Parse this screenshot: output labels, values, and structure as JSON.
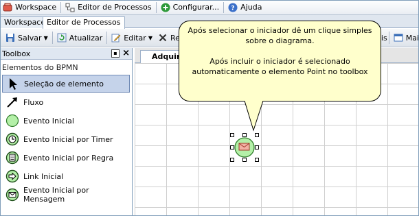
{
  "menubar": {
    "items": [
      {
        "label": "Workspace",
        "icon": "workspace-icon"
      },
      {
        "label": "Editor de Processos",
        "icon": "process-editor-icon"
      },
      {
        "label": "Configurar...",
        "icon": "add-icon"
      },
      {
        "label": "Ajuda",
        "icon": "help-icon"
      }
    ]
  },
  "tabs": [
    {
      "label": "Workspace",
      "active": false
    },
    {
      "label": "Editor de Processos",
      "active": true
    }
  ],
  "toolbar": {
    "save_label": "Salvar",
    "refresh_label": "Atualizar",
    "edit_label": "Editar",
    "remove_label": "Rem",
    "roles_label": "éis",
    "more_label": "Mai"
  },
  "toolbox": {
    "title": "Toolbox",
    "group_label": "Elementos do BPMN",
    "items": [
      {
        "label": "Seleção de elemento",
        "icon": "cursor-icon",
        "selected": true
      },
      {
        "label": "Fluxo",
        "icon": "flow-arrow-icon",
        "selected": false
      },
      {
        "label": "Evento Inicial",
        "icon": "start-event-icon",
        "selected": false
      },
      {
        "label": "Evento Inicial por Timer",
        "icon": "timer-start-event-icon",
        "selected": false
      },
      {
        "label": "Evento Inicial por Regra",
        "icon": "rule-start-event-icon",
        "selected": false
      },
      {
        "label": "Link Inicial",
        "icon": "link-start-event-icon",
        "selected": false
      },
      {
        "label": "Evento Inicial por Mensagem",
        "icon": "message-start-event-icon",
        "selected": false
      }
    ]
  },
  "editor": {
    "doc_tab_label": "Adquir"
  },
  "callout": {
    "line1": "Após selecionar o iniciador dê um clique simples sobre o diagrama.",
    "line2": "Após incluir o iniciador é selecionado automaticamente o elemento Point no toolbox"
  },
  "colors": {
    "start_event_fill": "#b4f0a8",
    "start_event_stroke": "#2f7d2a",
    "callout_fill": "#ffffcc",
    "grid_line": "#cfcfcf"
  }
}
